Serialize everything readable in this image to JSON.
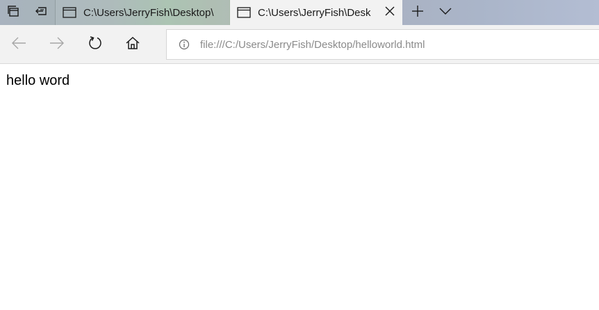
{
  "tabs": [
    {
      "title": "C:\\Users\\JerryFish\\Desktop\\",
      "active": false
    },
    {
      "title": "C:\\Users\\JerryFish\\Desk",
      "active": true
    }
  ],
  "address_bar": {
    "url": "file:///C:/Users/JerryFish/Desktop/helloworld.html"
  },
  "page": {
    "body_text": "hello word"
  },
  "icons": {
    "tab_manager": "tabs-stack-icon",
    "set_aside": "set-aside-tabs-icon",
    "tab_page": "page-icon",
    "close": "close-icon",
    "new_tab": "plus-icon",
    "tab_menu": "chevron-down-icon",
    "back": "arrow-left-icon",
    "forward": "arrow-right-icon",
    "refresh": "refresh-icon",
    "home": "home-icon",
    "info": "info-icon"
  }
}
